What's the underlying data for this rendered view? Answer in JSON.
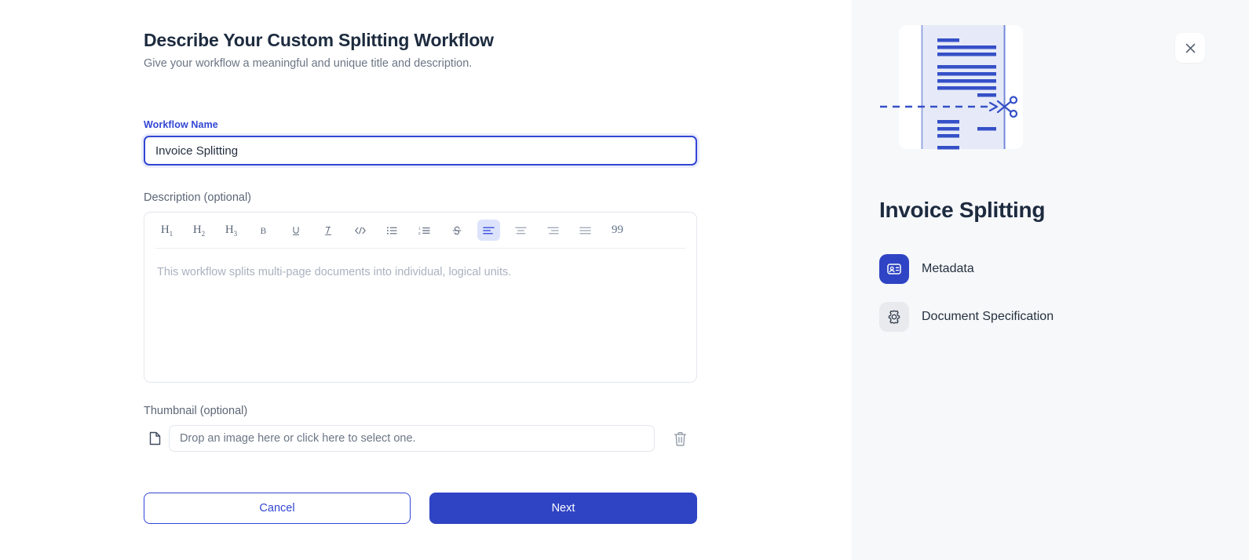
{
  "form": {
    "title": "Describe Your Custom Splitting Workflow",
    "subtitle": "Give your workflow a meaningful and unique title and description.",
    "name_field": {
      "label": "Workflow Name",
      "value": "Invoice Splitting",
      "placeholder": ""
    },
    "description_field": {
      "label": "Description (optional)",
      "value": "",
      "placeholder": "This workflow splits multi-page documents into individual, logical units."
    },
    "thumbnail_field": {
      "label": "Thumbnail (optional)",
      "value": "",
      "placeholder": "Drop an image here or click here to select one.",
      "file_icon": "file-icon",
      "delete_icon": "trash-icon"
    },
    "toolbar": [
      {
        "name": "heading-1",
        "glyph": "H",
        "sub": "1",
        "kind": "heading",
        "active": false
      },
      {
        "name": "heading-2",
        "glyph": "H",
        "sub": "2",
        "kind": "heading",
        "active": false
      },
      {
        "name": "heading-3",
        "glyph": "H",
        "sub": "3",
        "kind": "heading",
        "active": false
      },
      {
        "name": "bold",
        "glyph": "B",
        "kind": "bold",
        "active": false
      },
      {
        "name": "underline",
        "glyph": "U",
        "kind": "underline",
        "active": false
      },
      {
        "name": "italic",
        "glyph": "I",
        "kind": "italic",
        "active": false
      },
      {
        "name": "code-block",
        "glyph": "</>",
        "kind": "code",
        "active": false
      },
      {
        "name": "bullet-list",
        "glyph": "",
        "kind": "bullet-list",
        "active": false
      },
      {
        "name": "numbered-list",
        "glyph": "",
        "kind": "numbered-list",
        "active": false
      },
      {
        "name": "strikethrough",
        "glyph": "S",
        "kind": "strike",
        "active": false
      },
      {
        "name": "align-left",
        "glyph": "",
        "kind": "align-left",
        "active": true
      },
      {
        "name": "align-center",
        "glyph": "",
        "kind": "align-center",
        "active": false
      },
      {
        "name": "align-right",
        "glyph": "",
        "kind": "align-right",
        "active": false
      },
      {
        "name": "align-justify",
        "glyph": "",
        "kind": "align-justify",
        "active": false
      },
      {
        "name": "blockquote",
        "glyph": "99",
        "kind": "quote",
        "active": false
      }
    ],
    "buttons": {
      "cancel": "Cancel",
      "next": "Next"
    }
  },
  "panel": {
    "title": "Invoice Splitting",
    "close_icon": "close-icon",
    "illustration": "document-split-scissors-illustration",
    "items": [
      {
        "label": "Metadata",
        "icon": "id-card-icon",
        "active": true
      },
      {
        "label": "Document Specification",
        "icon": "gear-icon",
        "active": false
      }
    ]
  },
  "colors": {
    "accent": "#2f44c4",
    "accent_text": "#3246d3",
    "active_toolbar_bg": "#dde3fa",
    "panel_bg": "#f7f8fa",
    "heading": "#1d2b3f",
    "muted_text": "#6b7685",
    "illustration_blue": "#3550c7",
    "illustration_page": "#e6eaf8"
  }
}
